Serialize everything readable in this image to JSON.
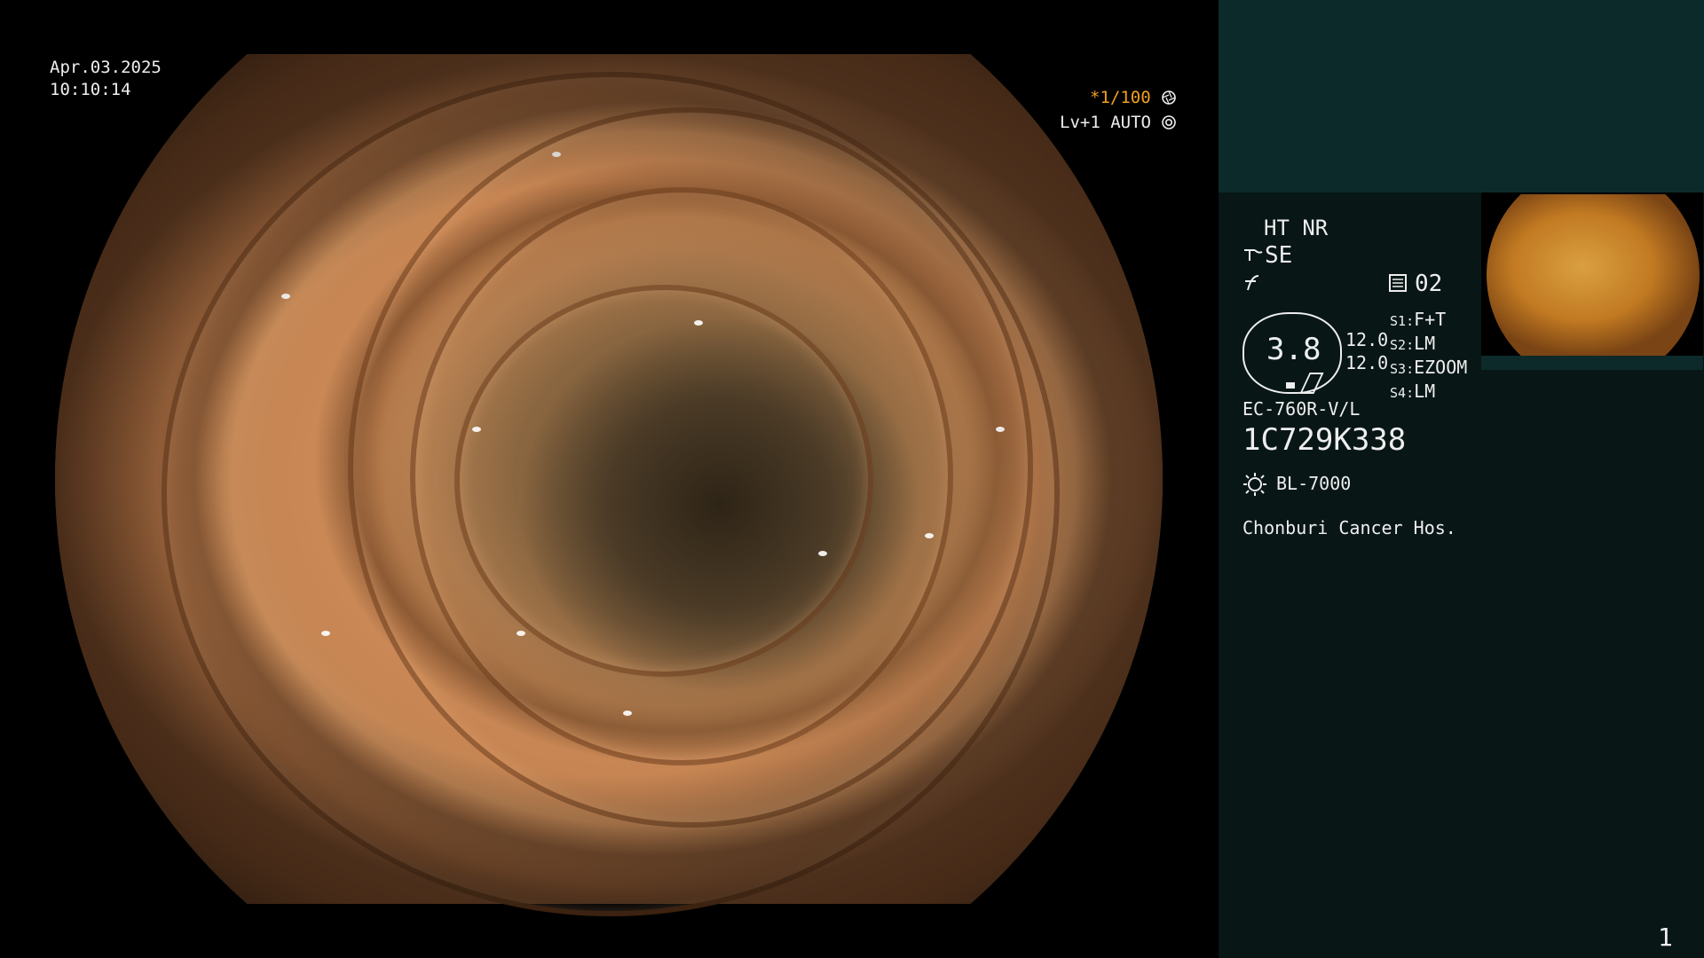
{
  "endoscope_view": {
    "date": "Apr.03.2025",
    "time": "10:10:14",
    "shutter": "*1/100",
    "shutter_icon": "aperture-icon",
    "level": "Lv+1 AUTO",
    "level_icon": "iris-icon"
  },
  "side_panel": {
    "enhancement": "HT NR",
    "structure_icon": "structure-enhance-icon",
    "structure_mode": "SE",
    "color_icon": "color-mode-icon",
    "memory_icon": "memory-icon",
    "memory_count": "02",
    "zoom_value": "3.8",
    "scale_top": "12.0",
    "scale_bottom": "12.0",
    "switches": [
      {
        "key": "S1",
        "value": "F+T"
      },
      {
        "key": "S2",
        "value": "LM"
      },
      {
        "key": "S3",
        "value": "EZOOM"
      },
      {
        "key": "S4",
        "value": "LM"
      }
    ],
    "scope_model": "EC-760R-V/L",
    "serial": "1C729K338",
    "light_icon": "light-source-icon",
    "light_source": "BL-7000",
    "hospital": "Chonburi Cancer Hos.",
    "page_number": "1"
  },
  "colors": {
    "panel_top": "#0d2a2a",
    "panel_bottom": "#081616",
    "accent_orange": "#f0a020",
    "text": "#eeeeee"
  }
}
